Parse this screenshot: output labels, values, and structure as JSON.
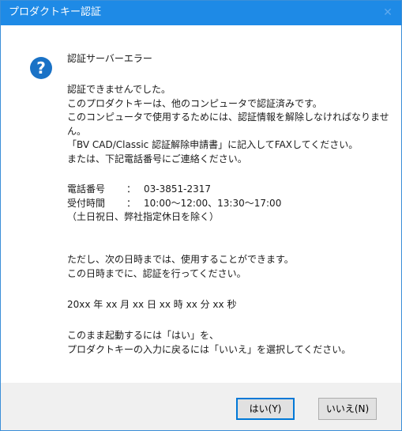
{
  "window": {
    "title": "プロダクトキー認証",
    "close_glyph": "✕",
    "icon": "question-icon",
    "accent_color": "#1e8ae6"
  },
  "message": {
    "title": "認証サーバーエラー",
    "main_lines": [
      "認証できませんでした。",
      "このプロダクトキーは、他のコンピュータで認証済みです。",
      "このコンピュータで使用するためには、認証情報を解除しなければなりませ",
      "ん。",
      "「BV CAD/Classic 認証解除申請書」に記入してFAXしてください。",
      "または、下記電話番号にご連絡ください。"
    ],
    "contact": {
      "phone_label": "電話番号",
      "phone_value": "03-3851-2317",
      "hours_label": "受付時間",
      "hours_value": "10:00～12:00、13:30～17:00",
      "separator": "：",
      "note": "（土日祝日、弊社指定休日を除く）"
    },
    "deadline_lines": [
      "ただし、次の日時までは、使用することができます。",
      "この日時までに、認証を行ってください。"
    ],
    "deadline_date": "20xx 年 xx 月 xx 日 xx 時 xx 分 xx 秒",
    "instruction_lines": [
      "このまま起動するには「はい」を、",
      "プロダクトキーの入力に戻るには「いいえ」を選択してください。"
    ]
  },
  "buttons": {
    "yes": "はい(Y)",
    "no": "いいえ(N)"
  }
}
